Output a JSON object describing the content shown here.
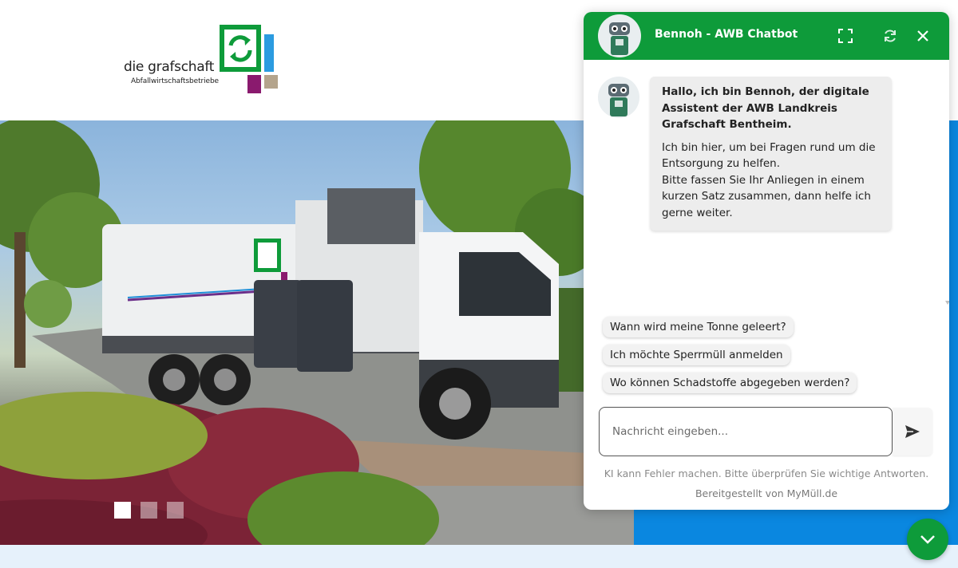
{
  "site": {
    "logo_text": "die grafschaft",
    "logo_subtext": "Abfallwirtschaftsbetriebe",
    "slider_dots": 3,
    "active_dot": 0
  },
  "colors": {
    "brand_green": "#0e9b3a",
    "brand_blue": "#0a87e0",
    "logo_purple": "#8a1a6e",
    "logo_tan": "#b4a48c",
    "logo_lightblue": "#2b9be0"
  },
  "chat": {
    "title": "Bennoh - AWB Chatbot",
    "header_icons": [
      "expand-icon",
      "refresh-icon",
      "close-icon"
    ],
    "message": {
      "bold": "Hallo, ich bin Bennoh, der digitale Assistent der AWB Landkreis Grafschaft Bentheim.",
      "body": "Ich bin hier, um bei Fragen rund um die Entsorgung zu helfen.\nBitte fassen Sie Ihr Anliegen in einem kurzen Satz zusammen, dann helfe ich gerne weiter."
    },
    "suggestions": [
      "Wann wird meine Tonne geleert?",
      "Ich möchte Sperrmüll anmelden",
      "Wo können Schadstoffe abgegeben werden?"
    ],
    "input_placeholder": "Nachricht eingeben...",
    "disclaimer_text": "KI kann Fehler machen. Bitte überprüfen Sie wichtige Antworten.",
    "provider_text": "Bereitgestellt von MyMüll.de"
  }
}
